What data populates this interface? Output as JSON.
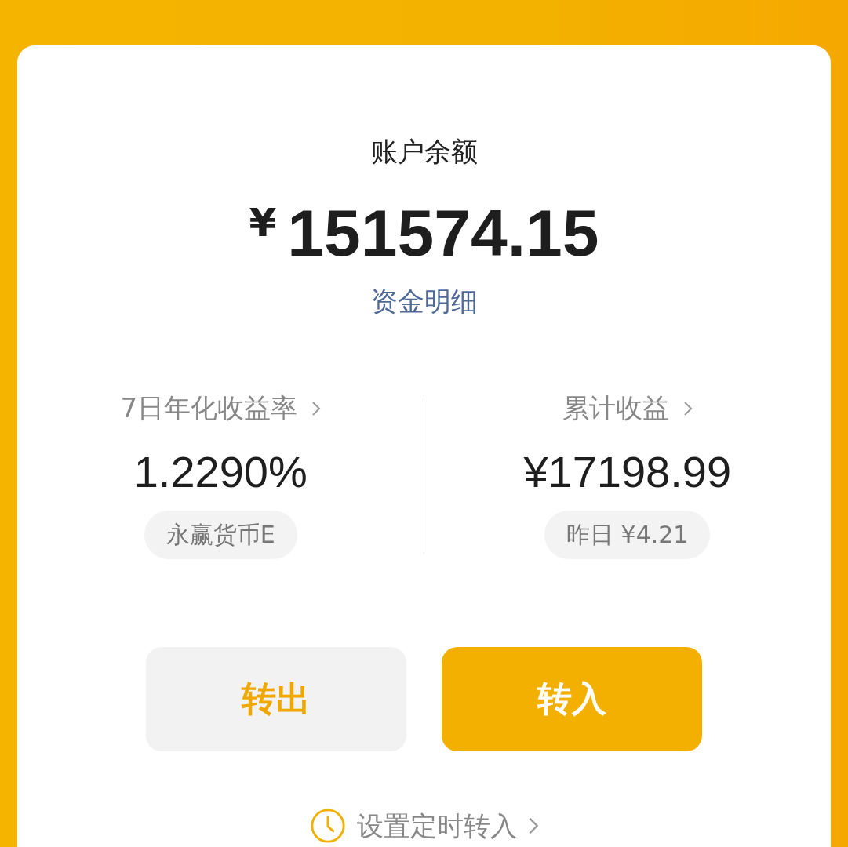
{
  "balance": {
    "label": "账户余额",
    "currency": "¥",
    "amount": "151574.15",
    "details_link": "资金明细"
  },
  "stats": [
    {
      "label": "7日年化收益率",
      "value": "1.2290%",
      "tag": "永赢货币E"
    },
    {
      "label": "累计收益",
      "value": "¥17198.99",
      "tag": "昨日 ¥4.21"
    }
  ],
  "buttons": [
    {
      "label": "转出",
      "kind": "secondary"
    },
    {
      "label": "转入",
      "kind": "primary"
    }
  ],
  "schedule_link": "设置定时转入"
}
